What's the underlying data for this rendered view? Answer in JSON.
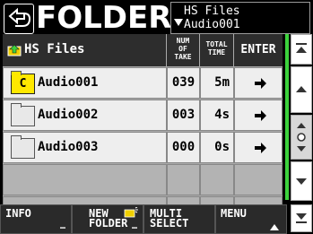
{
  "header": {
    "title": "FOLDER",
    "path_line1": "HS Files",
    "path_line2": "Audio001"
  },
  "table": {
    "header": {
      "name": "HS Files",
      "num_take": [
        "NUM",
        "OF",
        "TAKE"
      ],
      "total_time": [
        "TOTAL",
        "TIME"
      ],
      "enter": "ENTER"
    },
    "rows": [
      {
        "current_marker": "C",
        "name": "Audio001",
        "num_take": "039",
        "total_time": "5m",
        "enter_icon": "right-arrow-icon"
      },
      {
        "current_marker": "",
        "name": "Audio002",
        "num_take": "003",
        "total_time": "4s",
        "enter_icon": "right-arrow-icon"
      },
      {
        "current_marker": "",
        "name": "Audio003",
        "num_take": "000",
        "total_time": "0s",
        "enter_icon": "right-arrow-icon"
      }
    ]
  },
  "footer": {
    "info": [
      "INFO",
      ""
    ],
    "new_folder": [
      "NEW",
      "FOLDER"
    ],
    "multi_select": [
      "MULTI",
      "SELECT"
    ],
    "menu": [
      "MENU",
      ""
    ]
  },
  "colors": {
    "current_folder": "#ffe800",
    "scroll_indicator": "#3cd23c",
    "header_bg": "#2d2d2d",
    "cell_bg": "#eeeeee"
  },
  "icons": [
    "back-arrow-icon",
    "path-dropdown-icon",
    "folder-up-icon",
    "folder-icon",
    "right-arrow-icon",
    "scroll-top-icon",
    "scroll-up-icon",
    "scroll-thumb-icon",
    "scroll-down-icon",
    "scroll-bottom-icon",
    "new-folder-icon"
  ]
}
